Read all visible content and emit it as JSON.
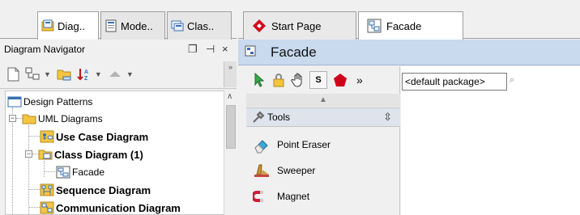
{
  "left_tabs": [
    {
      "label": "Diag.."
    },
    {
      "label": "Mode.."
    },
    {
      "label": "Clas.."
    }
  ],
  "navigator": {
    "title": "Diagram Navigator",
    "controls": {
      "restore": "❐",
      "pin": "⊣",
      "close": "×"
    }
  },
  "tree": {
    "items": [
      {
        "label": "Design Patterns",
        "icon": "project-icon"
      },
      {
        "label": "UML Diagrams",
        "icon": "folder-icon"
      },
      {
        "label": "Use Case Diagram",
        "icon": "use-case-diagram-icon"
      },
      {
        "label": "Class Diagram (1)",
        "icon": "class-diagram-folder-icon"
      },
      {
        "label": "Facade",
        "icon": "class-diagram-icon"
      },
      {
        "label": "Sequence Diagram",
        "icon": "sequence-diagram-icon"
      },
      {
        "label": "Communication Diagram",
        "icon": "communication-diagram-icon"
      }
    ]
  },
  "editor_tabs": [
    {
      "label": "Start Page"
    },
    {
      "label": "Facade"
    }
  ],
  "editor": {
    "title": "Facade",
    "package_placeholder": "<default package>"
  },
  "tools": {
    "header": "Tools",
    "items": [
      {
        "label": "Point Eraser",
        "icon": "eraser-icon"
      },
      {
        "label": "Sweeper",
        "icon": "sweeper-icon"
      },
      {
        "label": "Magnet",
        "icon": "magnet-icon"
      }
    ]
  },
  "toolbar": {
    "stamp_label": "S",
    "more": "»"
  },
  "colors": {
    "title_bar": "#c9d9ee",
    "accent_red": "#d0021b",
    "folder_yellow": "#f5c542"
  }
}
